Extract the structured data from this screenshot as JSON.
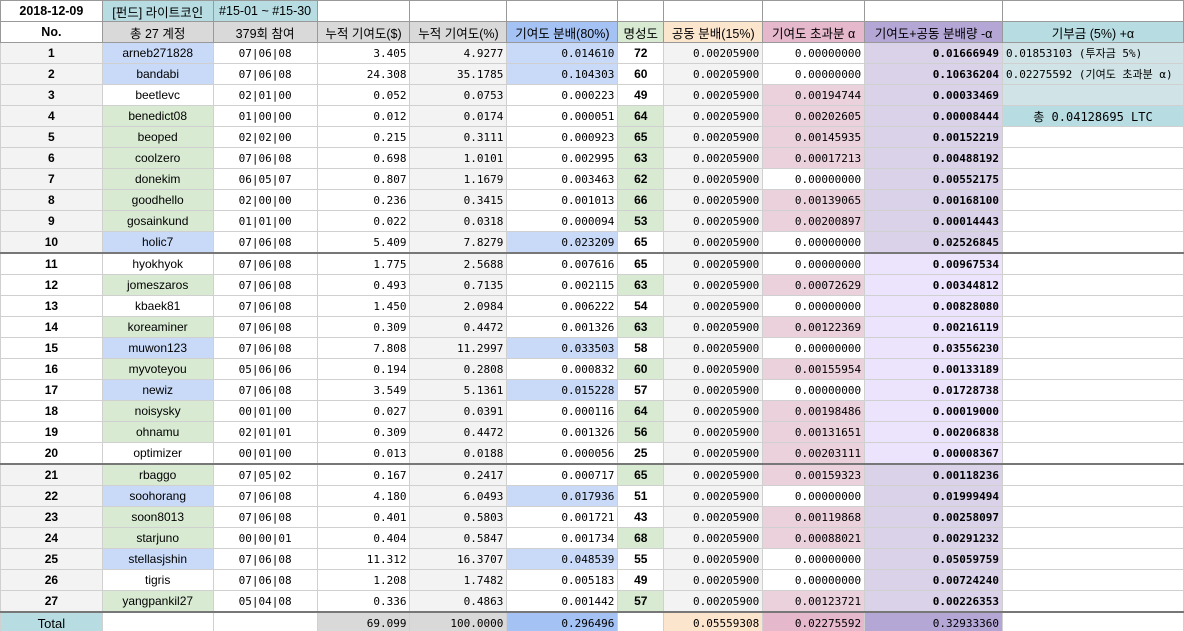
{
  "top": {
    "date": "2018-12-09",
    "fund": "[펀드] 라이트코인",
    "range": "#15-01 ~ #15-30"
  },
  "headers": [
    "No.",
    "총 27 계정",
    "379회 참여",
    "누적 기여도($)",
    "누적 기여도(%)",
    "기여도 분배(80%)",
    "명성도",
    "공동 분배(15%)",
    "기여도 초과분 α",
    "기여도+공동 분배량 -α",
    "기부금 (5%) +α"
  ],
  "side": {
    "line1": "0.01853103 (투자금 5%)",
    "line2": "0.02275592 (기여도 초과분 α)",
    "total": "총 0.04128695 LTC"
  },
  "rows": [
    {
      "no": "1",
      "name": "arneb271828",
      "part": "07|06|08",
      "usd": "3.405",
      "pct": "4.9277",
      "dist": "0.014610",
      "rep": "72",
      "common": "0.00205900",
      "excess": "0.00000000",
      "sum": "0.01666949",
      "nc": "blue",
      "rc": "",
      "dc": "blue"
    },
    {
      "no": "2",
      "name": "bandabi",
      "part": "07|06|08",
      "usd": "24.308",
      "pct": "35.1785",
      "dist": "0.104303",
      "rep": "60",
      "common": "0.00205900",
      "excess": "0.00000000",
      "sum": "0.10636204",
      "nc": "blue",
      "rc": "",
      "dc": "blue"
    },
    {
      "no": "3",
      "name": "beetlevc",
      "part": "02|01|00",
      "usd": "0.052",
      "pct": "0.0753",
      "dist": "0.000223",
      "rep": "49",
      "common": "0.00205900",
      "excess": "0.00194744",
      "sum": "0.00033469",
      "nc": "",
      "rc": "",
      "dc": ""
    },
    {
      "no": "4",
      "name": "benedict08",
      "part": "01|00|00",
      "usd": "0.012",
      "pct": "0.0174",
      "dist": "0.000051",
      "rep": "64",
      "common": "0.00205900",
      "excess": "0.00202605",
      "sum": "0.00008444",
      "nc": "green",
      "rc": "green",
      "dc": ""
    },
    {
      "no": "5",
      "name": "beoped",
      "part": "02|02|00",
      "usd": "0.215",
      "pct": "0.3111",
      "dist": "0.000923",
      "rep": "65",
      "common": "0.00205900",
      "excess": "0.00145935",
      "sum": "0.00152219",
      "nc": "green",
      "rc": "green",
      "dc": ""
    },
    {
      "no": "6",
      "name": "coolzero",
      "part": "07|06|08",
      "usd": "0.698",
      "pct": "1.0101",
      "dist": "0.002995",
      "rep": "63",
      "common": "0.00205900",
      "excess": "0.00017213",
      "sum": "0.00488192",
      "nc": "green",
      "rc": "green",
      "dc": ""
    },
    {
      "no": "7",
      "name": "donekim",
      "part": "06|05|07",
      "usd": "0.807",
      "pct": "1.1679",
      "dist": "0.003463",
      "rep": "62",
      "common": "0.00205900",
      "excess": "0.00000000",
      "sum": "0.00552175",
      "nc": "green",
      "rc": "green",
      "dc": ""
    },
    {
      "no": "8",
      "name": "goodhello",
      "part": "02|00|00",
      "usd": "0.236",
      "pct": "0.3415",
      "dist": "0.001013",
      "rep": "66",
      "common": "0.00205900",
      "excess": "0.00139065",
      "sum": "0.00168100",
      "nc": "green",
      "rc": "green",
      "dc": ""
    },
    {
      "no": "9",
      "name": "gosainkund",
      "part": "01|01|00",
      "usd": "0.022",
      "pct": "0.0318",
      "dist": "0.000094",
      "rep": "53",
      "common": "0.00205900",
      "excess": "0.00200897",
      "sum": "0.00014443",
      "nc": "green",
      "rc": "green",
      "dc": ""
    },
    {
      "no": "10",
      "name": "holic7",
      "part": "07|06|08",
      "usd": "5.409",
      "pct": "7.8279",
      "dist": "0.023209",
      "rep": "65",
      "common": "0.00205900",
      "excess": "0.00000000",
      "sum": "0.02526845",
      "nc": "blue",
      "rc": "",
      "dc": "blue"
    },
    {
      "no": "11",
      "name": "hyokhyok",
      "part": "07|06|08",
      "usd": "1.775",
      "pct": "2.5688",
      "dist": "0.007616",
      "rep": "65",
      "common": "0.00205900",
      "excess": "0.00000000",
      "sum": "0.00967534",
      "nc": "",
      "rc": "",
      "dc": ""
    },
    {
      "no": "12",
      "name": "jomeszaros",
      "part": "07|06|08",
      "usd": "0.493",
      "pct": "0.7135",
      "dist": "0.002115",
      "rep": "63",
      "common": "0.00205900",
      "excess": "0.00072629",
      "sum": "0.00344812",
      "nc": "green",
      "rc": "green",
      "dc": ""
    },
    {
      "no": "13",
      "name": "kbaek81",
      "part": "07|06|08",
      "usd": "1.450",
      "pct": "2.0984",
      "dist": "0.006222",
      "rep": "54",
      "common": "0.00205900",
      "excess": "0.00000000",
      "sum": "0.00828080",
      "nc": "",
      "rc": "",
      "dc": ""
    },
    {
      "no": "14",
      "name": "koreaminer",
      "part": "07|06|08",
      "usd": "0.309",
      "pct": "0.4472",
      "dist": "0.001326",
      "rep": "63",
      "common": "0.00205900",
      "excess": "0.00122369",
      "sum": "0.00216119",
      "nc": "green",
      "rc": "green",
      "dc": ""
    },
    {
      "no": "15",
      "name": "muwon123",
      "part": "07|06|08",
      "usd": "7.808",
      "pct": "11.2997",
      "dist": "0.033503",
      "rep": "58",
      "common": "0.00205900",
      "excess": "0.00000000",
      "sum": "0.03556230",
      "nc": "blue",
      "rc": "",
      "dc": "blue"
    },
    {
      "no": "16",
      "name": "myvoteyou",
      "part": "05|06|06",
      "usd": "0.194",
      "pct": "0.2808",
      "dist": "0.000832",
      "rep": "60",
      "common": "0.00205900",
      "excess": "0.00155954",
      "sum": "0.00133189",
      "nc": "green",
      "rc": "green",
      "dc": ""
    },
    {
      "no": "17",
      "name": "newiz",
      "part": "07|06|08",
      "usd": "3.549",
      "pct": "5.1361",
      "dist": "0.015228",
      "rep": "57",
      "common": "0.00205900",
      "excess": "0.00000000",
      "sum": "0.01728738",
      "nc": "blue",
      "rc": "",
      "dc": "blue"
    },
    {
      "no": "18",
      "name": "noisysky",
      "part": "00|01|00",
      "usd": "0.027",
      "pct": "0.0391",
      "dist": "0.000116",
      "rep": "64",
      "common": "0.00205900",
      "excess": "0.00198486",
      "sum": "0.00019000",
      "nc": "green",
      "rc": "green",
      "dc": ""
    },
    {
      "no": "19",
      "name": "ohnamu",
      "part": "02|01|01",
      "usd": "0.309",
      "pct": "0.4472",
      "dist": "0.001326",
      "rep": "56",
      "common": "0.00205900",
      "excess": "0.00131651",
      "sum": "0.00206838",
      "nc": "green",
      "rc": "green",
      "dc": ""
    },
    {
      "no": "20",
      "name": "optimizer",
      "part": "00|01|00",
      "usd": "0.013",
      "pct": "0.0188",
      "dist": "0.000056",
      "rep": "25",
      "common": "0.00205900",
      "excess": "0.00203111",
      "sum": "0.00008367",
      "nc": "",
      "rc": "",
      "dc": ""
    },
    {
      "no": "21",
      "name": "rbaggo",
      "part": "07|05|02",
      "usd": "0.167",
      "pct": "0.2417",
      "dist": "0.000717",
      "rep": "65",
      "common": "0.00205900",
      "excess": "0.00159323",
      "sum": "0.00118236",
      "nc": "green",
      "rc": "green",
      "dc": ""
    },
    {
      "no": "22",
      "name": "soohorang",
      "part": "07|06|08",
      "usd": "4.180",
      "pct": "6.0493",
      "dist": "0.017936",
      "rep": "51",
      "common": "0.00205900",
      "excess": "0.00000000",
      "sum": "0.01999494",
      "nc": "blue",
      "rc": "",
      "dc": "blue"
    },
    {
      "no": "23",
      "name": "soon8013",
      "part": "07|06|08",
      "usd": "0.401",
      "pct": "0.5803",
      "dist": "0.001721",
      "rep": "43",
      "common": "0.00205900",
      "excess": "0.00119868",
      "sum": "0.00258097",
      "nc": "green",
      "rc": "",
      "dc": ""
    },
    {
      "no": "24",
      "name": "starjuno",
      "part": "00|00|01",
      "usd": "0.404",
      "pct": "0.5847",
      "dist": "0.001734",
      "rep": "68",
      "common": "0.00205900",
      "excess": "0.00088021",
      "sum": "0.00291232",
      "nc": "green",
      "rc": "green",
      "dc": ""
    },
    {
      "no": "25",
      "name": "stellasjshin",
      "part": "07|06|08",
      "usd": "11.312",
      "pct": "16.3707",
      "dist": "0.048539",
      "rep": "55",
      "common": "0.00205900",
      "excess": "0.00000000",
      "sum": "0.05059759",
      "nc": "blue",
      "rc": "",
      "dc": "blue"
    },
    {
      "no": "26",
      "name": "tigris",
      "part": "07|06|08",
      "usd": "1.208",
      "pct": "1.7482",
      "dist": "0.005183",
      "rep": "49",
      "common": "0.00205900",
      "excess": "0.00000000",
      "sum": "0.00724240",
      "nc": "",
      "rc": "",
      "dc": ""
    },
    {
      "no": "27",
      "name": "yangpankil27",
      "part": "05|04|08",
      "usd": "0.336",
      "pct": "0.4863",
      "dist": "0.001442",
      "rep": "57",
      "common": "0.00205900",
      "excess": "0.00123721",
      "sum": "0.00226353",
      "nc": "green",
      "rc": "green",
      "dc": ""
    }
  ],
  "total": {
    "label": "Total",
    "usd": "69.099",
    "pct": "100.0000",
    "dist": "0.296496",
    "common": "0.05559308",
    "excess": "0.02275592",
    "sum": "0.32933360"
  }
}
